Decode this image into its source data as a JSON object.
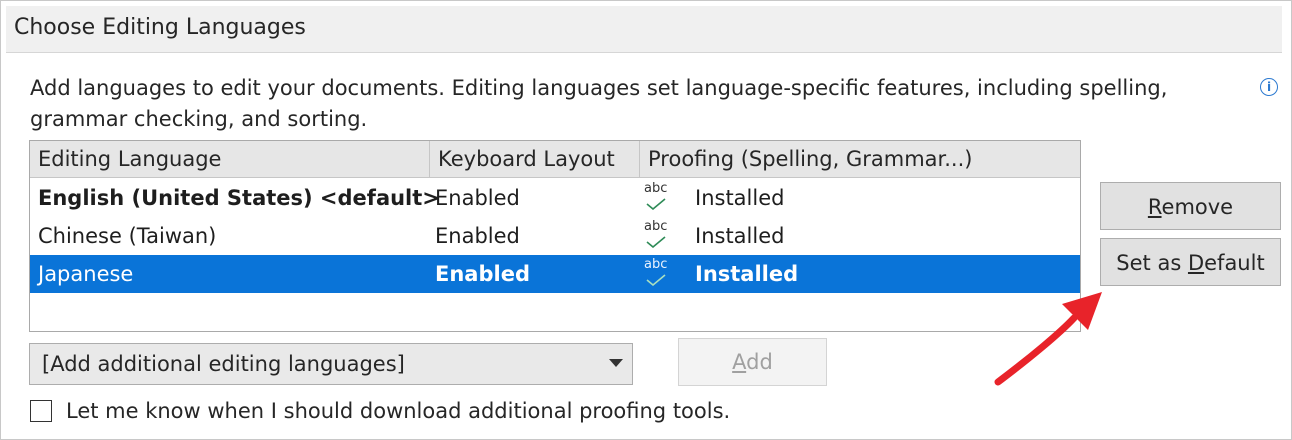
{
  "section": {
    "title": "Choose Editing Languages"
  },
  "description": "Add languages to edit your documents. Editing languages set language-specific features, including spelling, grammar checking, and sorting.",
  "info_icon": "i",
  "table": {
    "columns": [
      "Editing Language",
      "Keyboard Layout",
      "Proofing (Spelling, Grammar...)"
    ],
    "rows": [
      {
        "language": "English (United States) <default>",
        "keyboard": "Enabled",
        "proofing_icon": "abc",
        "proofing": "Installed",
        "is_default": true,
        "selected": false
      },
      {
        "language": "Chinese (Taiwan)",
        "keyboard": "Enabled",
        "proofing_icon": "abc",
        "proofing": "Installed",
        "is_default": false,
        "selected": false
      },
      {
        "language": "Japanese",
        "keyboard": "Enabled",
        "proofing_icon": "abc",
        "proofing": "Installed",
        "is_default": false,
        "selected": true
      }
    ]
  },
  "buttons": {
    "remove": {
      "pre": "",
      "accel": "R",
      "post": "emove"
    },
    "set_default": {
      "pre": "Set as ",
      "accel": "D",
      "post": "efault"
    },
    "add": {
      "pre": "",
      "accel": "A",
      "post": "dd",
      "enabled": false
    }
  },
  "add_language_combo": {
    "value": "[Add additional editing languages]"
  },
  "proofing_tools_checkbox": {
    "label": "Let me know when I should download additional proofing tools.",
    "checked": false
  },
  "colors": {
    "selection": "#0a74d8",
    "annotation_arrow": "#e8232a",
    "check": "#2e8b57"
  },
  "icons": {
    "info": "info-icon",
    "proofing": "abc-check-icon",
    "dropdown": "chevron-down-icon",
    "annotation": "red-arrow-icon"
  }
}
